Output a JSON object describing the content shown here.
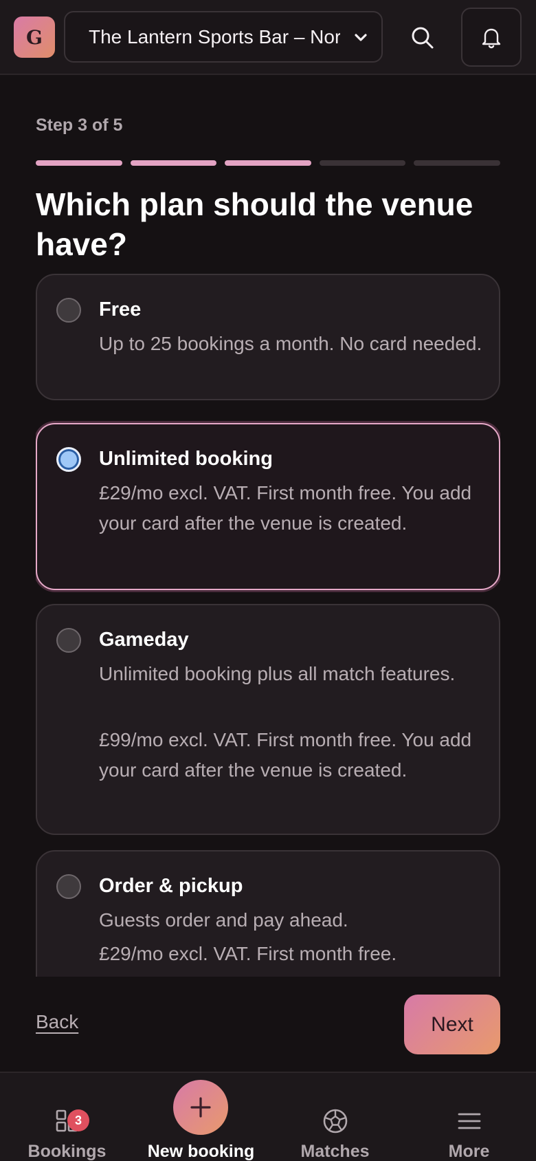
{
  "app": {
    "logo_letter": "G",
    "venue_selector": "The Lantern Sports Bar – North"
  },
  "wizard": {
    "step_label": "Step 3 of 5",
    "progress": {
      "current_step": 3,
      "total_steps": 5
    },
    "heading": "Which plan should the venue have?"
  },
  "plans": [
    {
      "title": "Free",
      "lines": [
        "Up to 25 bookings a month. No card needed."
      ],
      "selected": false
    },
    {
      "title": "Unlimited booking",
      "lines": [
        "£29/mo excl. VAT. First month free. You add your card after the venue is created."
      ],
      "selected": true
    },
    {
      "title": "Gameday",
      "lines": [
        "Unlimited booking plus all match features.",
        "£99/mo excl. VAT. First month free. You add your card after the venue is created."
      ],
      "selected": false
    },
    {
      "title": "Order & pickup",
      "lines": [
        "Guests order and pay ahead.",
        "£29/mo excl. VAT. First month free."
      ],
      "selected": false
    }
  ],
  "actions": {
    "back_label": "Back",
    "next_label": "Next"
  },
  "bottom_nav": {
    "bookings_label": "Bookings",
    "bookings_badge": "3",
    "new_booking_label": "New booking",
    "matches_label": "Matches",
    "more_label": "More"
  },
  "colors": {
    "background": "#151113",
    "accent_pink": "#e3a3c3",
    "accent_orange": "#e89a6c",
    "radio_selected": "#9fc8f7",
    "badge": "#e0505f"
  },
  "icons": [
    "search-icon",
    "bell-icon",
    "chevron-down-icon",
    "grid-icon",
    "plus-icon",
    "soccer-ball-icon",
    "menu-icon"
  ]
}
